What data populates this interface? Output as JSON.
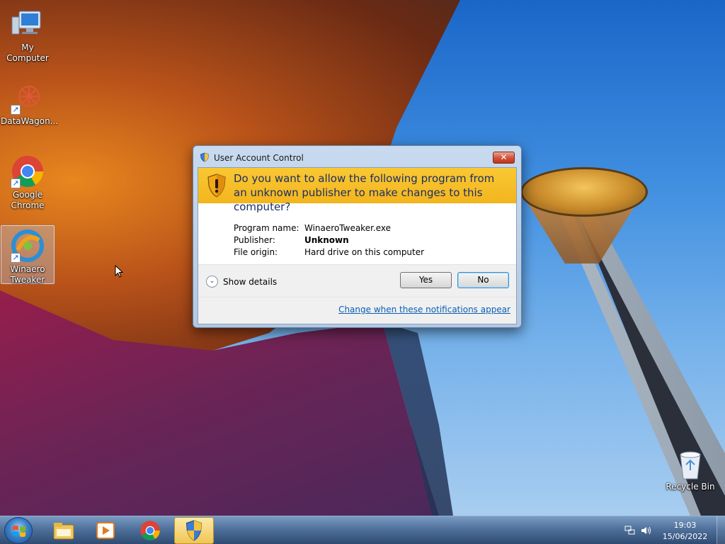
{
  "desktop": {
    "icons": [
      {
        "label": "My Computer",
        "icon": "computer-icon"
      },
      {
        "label": "DataWagon...",
        "icon": "datawagon-icon"
      },
      {
        "label": "Google Chrome",
        "icon": "chrome-icon"
      },
      {
        "label": "Winaero Tweaker",
        "icon": "winaero-tweaker-icon"
      }
    ],
    "recycle_bin": {
      "label": "Recycle Bin",
      "icon": "recycle-bin-icon"
    }
  },
  "uac": {
    "title": "User Account Control",
    "close_glyph": "✕",
    "question": "Do you want to allow the following program from an unknown publisher to make changes to this computer?",
    "details": [
      {
        "label": "Program name:",
        "value": "WinaeroTweaker.exe"
      },
      {
        "label": "Publisher:",
        "value": "Unknown"
      },
      {
        "label": "File origin:",
        "value": "Hard drive on this computer"
      }
    ],
    "show_details": "Show details",
    "yes": "Yes",
    "no": "No",
    "change_link": "Change when these notifications appear",
    "header_color": "#F5BC22"
  },
  "taskbar": {
    "apps": [
      "windows-explorer-icon",
      "media-player-icon",
      "chrome-icon",
      "uac-shield-icon"
    ],
    "clock": {
      "time": "19:03",
      "date": "15/06/2022"
    }
  }
}
